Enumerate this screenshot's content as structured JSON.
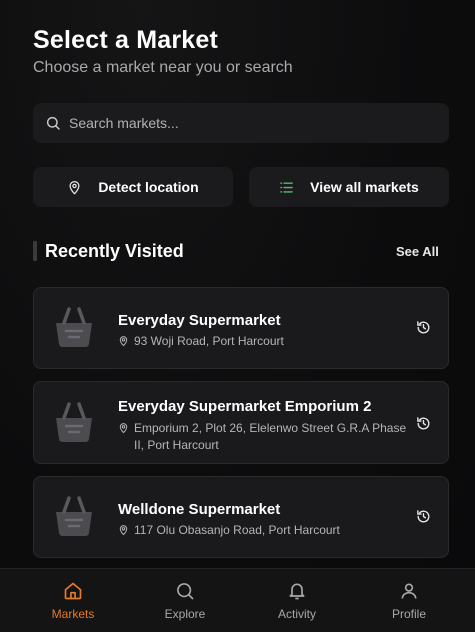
{
  "header": {
    "title": "Select a Market",
    "subtitle": "Choose a market near you or search"
  },
  "search": {
    "placeholder": "Search markets...",
    "icon": "search-icon"
  },
  "actions": {
    "detect_label": "Detect location",
    "view_all_label": "View all markets"
  },
  "recent": {
    "title": "Recently Visited",
    "see_all": "See All",
    "items": [
      {
        "name": "Everyday Supermarket",
        "address": "93 Woji Road, Port Harcourt"
      },
      {
        "name": "Everyday Supermarket Emporium 2",
        "address": "Emporium 2, Plot 26, Elelenwo Street G.R.A Phase II, Port Harcourt"
      },
      {
        "name": "Welldone Supermarket",
        "address": "117 Olu Obasanjo Road, Port Harcourt"
      }
    ]
  },
  "nav": {
    "items": [
      {
        "label": "Markets",
        "icon": "home-icon",
        "active": true
      },
      {
        "label": "Explore",
        "icon": "search-icon",
        "active": false
      },
      {
        "label": "Activity",
        "icon": "bell-icon",
        "active": false
      },
      {
        "label": "Profile",
        "icon": "user-icon",
        "active": false
      }
    ]
  },
  "colors": {
    "accent": "#e67a2b",
    "background": "#0d0d0e",
    "card": "#1a1a1c",
    "view_all_icon": "#4fbf7a"
  }
}
